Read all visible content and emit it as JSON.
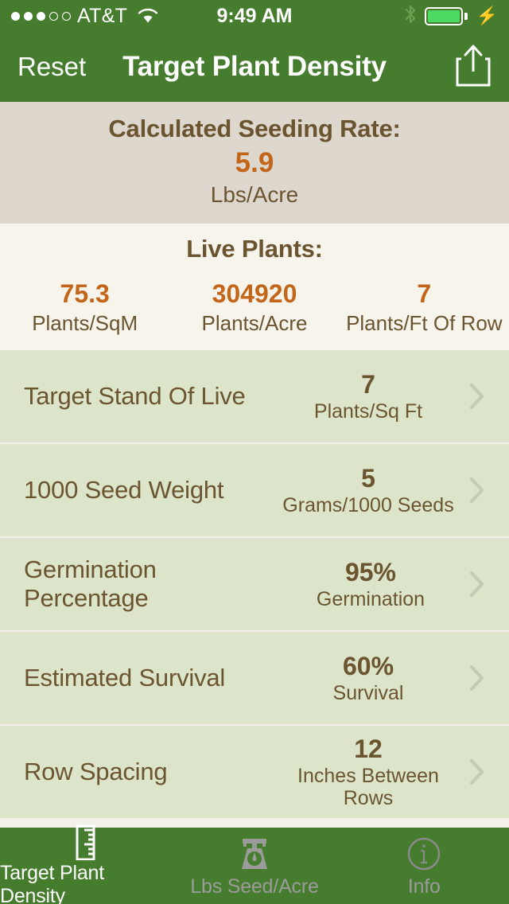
{
  "statusbar": {
    "carrier": "AT&T",
    "signal_dots_filled": 3,
    "signal_dots_total": 5,
    "wifi_icon": "wifi-icon",
    "time": "9:49 AM",
    "bluetooth_icon": "bluetooth-icon",
    "battery_icon": "battery-icon",
    "charging_icon": "lightning-bolt-icon",
    "battery_color": "#4cd964"
  },
  "navbar": {
    "reset_label": "Reset",
    "title": "Target Plant Density",
    "share_icon": "share-icon",
    "background_color": "#467c2e"
  },
  "calculated": {
    "title": "Calculated Seeding Rate:",
    "value": "5.9",
    "units": "Lbs/Acre",
    "accent_color": "#c4661a",
    "background_color": "#ded7ce"
  },
  "live_plants": {
    "title": "Live Plants:",
    "background_color": "#f7f4ec",
    "cells": [
      {
        "value": "75.3",
        "label": "Plants/SqM"
      },
      {
        "value": "304920",
        "label": "Plants/Acre"
      },
      {
        "value": "7",
        "label": "Plants/Ft Of Row"
      }
    ]
  },
  "rows": {
    "background_color": "#dce4ca",
    "items": [
      {
        "label": "Target Stand Of Live",
        "value": "7",
        "unit": "Plants/Sq Ft",
        "chevron": "chevron-right-icon"
      },
      {
        "label": "1000 Seed Weight",
        "value": "5",
        "unit": "Grams/1000 Seeds",
        "chevron": "chevron-right-icon"
      },
      {
        "label": "Germination Percentage",
        "value": "95%",
        "unit": "Germination",
        "chevron": "chevron-right-icon"
      },
      {
        "label": "Estimated Survival",
        "value": "60%",
        "unit": "Survival",
        "chevron": "chevron-right-icon"
      },
      {
        "label": "Row Spacing",
        "value": "12",
        "unit": "Inches Between Rows",
        "chevron": "chevron-right-icon"
      }
    ]
  },
  "tabbar": {
    "background_color": "#467c2e",
    "tabs": [
      {
        "label": "Target Plant Density",
        "icon": "ruler-icon",
        "active": true
      },
      {
        "label": "Lbs Seed/Acre",
        "icon": "kitchen-scale-icon",
        "active": false
      },
      {
        "label": "Info",
        "icon": "info-circle-icon",
        "active": false
      }
    ]
  }
}
